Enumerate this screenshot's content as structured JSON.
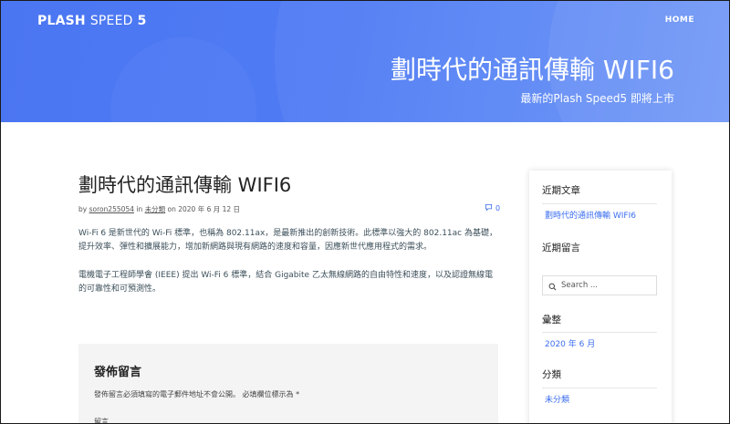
{
  "header": {
    "site_title_part1": "PLASH",
    "site_title_part2": "SPEED",
    "site_title_part3": "5",
    "nav_home": "HOME",
    "hero_title": "劃時代的通訊傳輸 WIFI6",
    "hero_subtitle": "最新的Plash Speed5 即將上市"
  },
  "post": {
    "title": "劃時代的通訊傳輸 WIFI6",
    "meta_by": "by",
    "author": "soron255054",
    "meta_in": "in",
    "category": "未分類",
    "meta_on": "on 2020 年 6 月 12 日",
    "comment_count": "0",
    "paragraph1": "Wi-Fi 6 是新世代的 Wi-Fi 標準，也稱為 802.11ax，是最新推出的創新技術。此標準以強大的 802.11ac 為基礎，提升效率、彈性和擴展能力，增加新網路與現有網路的速度和容量，因應新世代應用程式的需求。",
    "paragraph2": "電機電子工程師學會 (IEEE) 提出 Wi-Fi 6 標準，結合 Gigabite 乙太無線網路的自由特性和速度，以及認證無線電的可靠性和可預測性。"
  },
  "comment_form": {
    "title": "發佈留言",
    "note": "發佈留言必須填寫的電子郵件地址不會公開。 必填欄位標示為 *",
    "field_label": "留言"
  },
  "sidebar": {
    "recent_posts_heading": "近期文章",
    "recent_post_1": "劃時代的通訊傳輸 WIFI6",
    "recent_comments_heading": "近期留言",
    "search_placeholder": "Search ...",
    "archives_heading": "彙整",
    "archive_1": "2020 年 6 月",
    "categories_heading": "分類",
    "category_1": "未分類"
  },
  "colors": {
    "accent": "#3b6df0",
    "hero_blue": "#4f7bf4"
  }
}
